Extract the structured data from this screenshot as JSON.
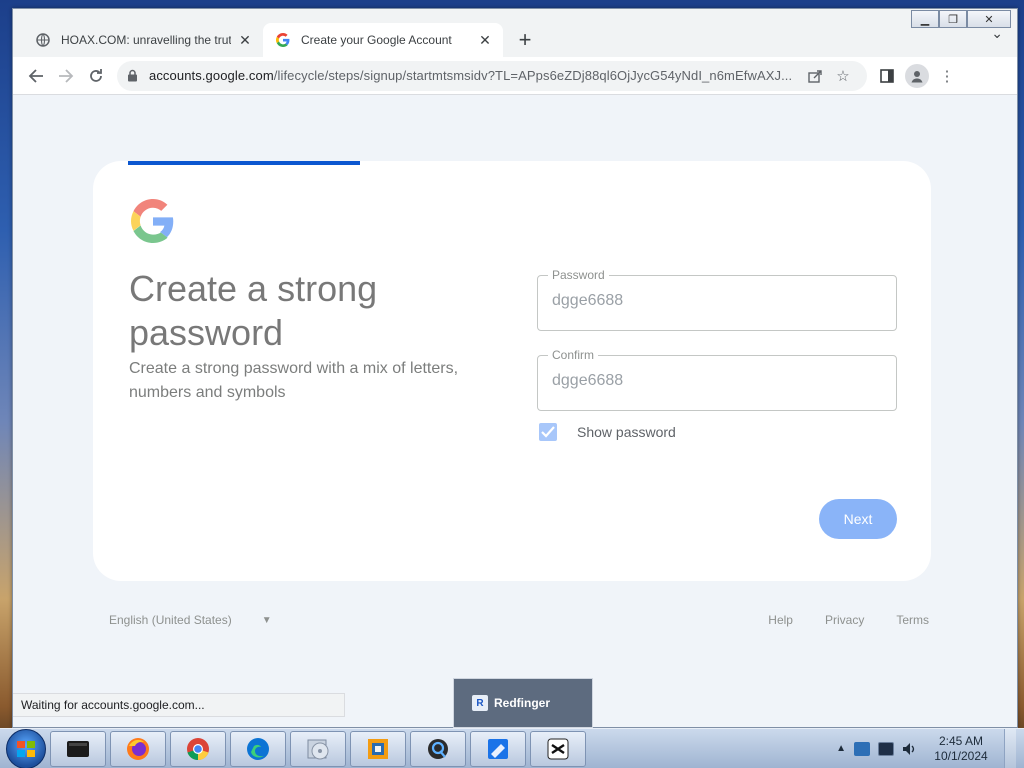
{
  "browser": {
    "tabs": [
      {
        "title": "HOAX.COM: unravelling the truth",
        "active": false
      },
      {
        "title": "Create your Google Account",
        "active": true
      }
    ],
    "url_host": "accounts.google.com",
    "url_path": "/lifecycle/steps/signup/startmtsmsidv?TL=APps6eZDj88ql6OjJycG54yNdI_n6mEfwAXJ..."
  },
  "page": {
    "headline": "Create a strong password",
    "subtext": "Create a strong password with a mix of letters, numbers and symbols",
    "password_label": "Password",
    "password_value": "dgge6688",
    "confirm_label": "Confirm",
    "confirm_value": "dgge6688",
    "show_password_label": "Show password",
    "show_password_checked": true,
    "next_label": "Next",
    "language": "English (United States)",
    "footer_links": [
      "Help",
      "Privacy",
      "Terms"
    ],
    "progress_fraction": 0.28
  },
  "status_text": "Waiting for accounts.google.com...",
  "taskbar": {
    "popup_label": "Redfinger",
    "clock_time": "2:45 AM",
    "clock_date": "10/1/2024"
  },
  "colors": {
    "accent": "#0b57d0",
    "next_button": "#8ab4f8",
    "page_bg": "#f0f4f9"
  }
}
